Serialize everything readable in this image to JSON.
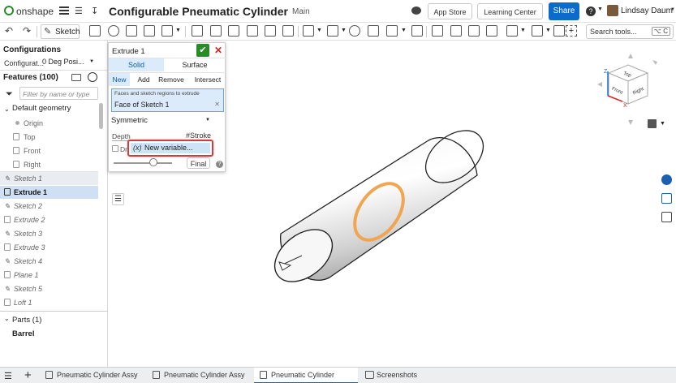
{
  "app": {
    "logo_text": "onshape",
    "doc_title": "Configurable Pneumatic Cylinder",
    "branch": "Main",
    "app_store_label": "App Store",
    "learning_center_label": "Learning Center",
    "share_label": "Share",
    "help_label": "?",
    "user_name": "Lindsay Daum",
    "brand_color": "#0b6bcb"
  },
  "toolbar": {
    "sketch_label": "Sketch",
    "search_placeholder": "Search tools...",
    "shortcut": "⌥ C"
  },
  "left": {
    "configurations_title": "Configurations",
    "config_label": "Configurat...",
    "config_value": "0 Deg Posi...",
    "features_title": "Features (100)",
    "filter_placeholder": "Filter by name or type",
    "default_geometry": "Default geometry",
    "items": [
      {
        "label": "Origin"
      },
      {
        "label": "Top"
      },
      {
        "label": "Front"
      },
      {
        "label": "Right"
      },
      {
        "label": "Sketch 1"
      },
      {
        "label": "Extrude 1"
      },
      {
        "label": "Sketch 2"
      },
      {
        "label": "Extrude 2"
      },
      {
        "label": "Sketch 3"
      },
      {
        "label": "Extrude 3"
      },
      {
        "label": "Sketch 4"
      },
      {
        "label": "Plane 1"
      },
      {
        "label": "Sketch 5"
      },
      {
        "label": "Loft 1"
      }
    ],
    "parts_title": "Parts (1)",
    "part_name": "Barrel"
  },
  "dialog": {
    "title": "Extrude 1",
    "type_tabs": [
      "Solid",
      "Surface"
    ],
    "op_tabs": [
      "New",
      "Add",
      "Remove",
      "Intersect"
    ],
    "faces_label": "Faces and sketch regions to extrude",
    "faces_value": "Face of Sketch 1",
    "end_type": "Symmetric",
    "depth_label": "Depth",
    "depth_value": "#Stroke",
    "draft_label": "Dra",
    "new_variable": "New variable...",
    "final_label": "Final"
  },
  "view_cube": {
    "top": "Top",
    "front": "Front",
    "right": "Right",
    "z": "Z",
    "x": "X"
  },
  "tabs": [
    {
      "label": "Pneumatic Cylinder Assy"
    },
    {
      "label": "Pneumatic Cylinder Assy"
    },
    {
      "label": "Pneumatic Cylinder"
    },
    {
      "label": "Screenshots"
    }
  ]
}
